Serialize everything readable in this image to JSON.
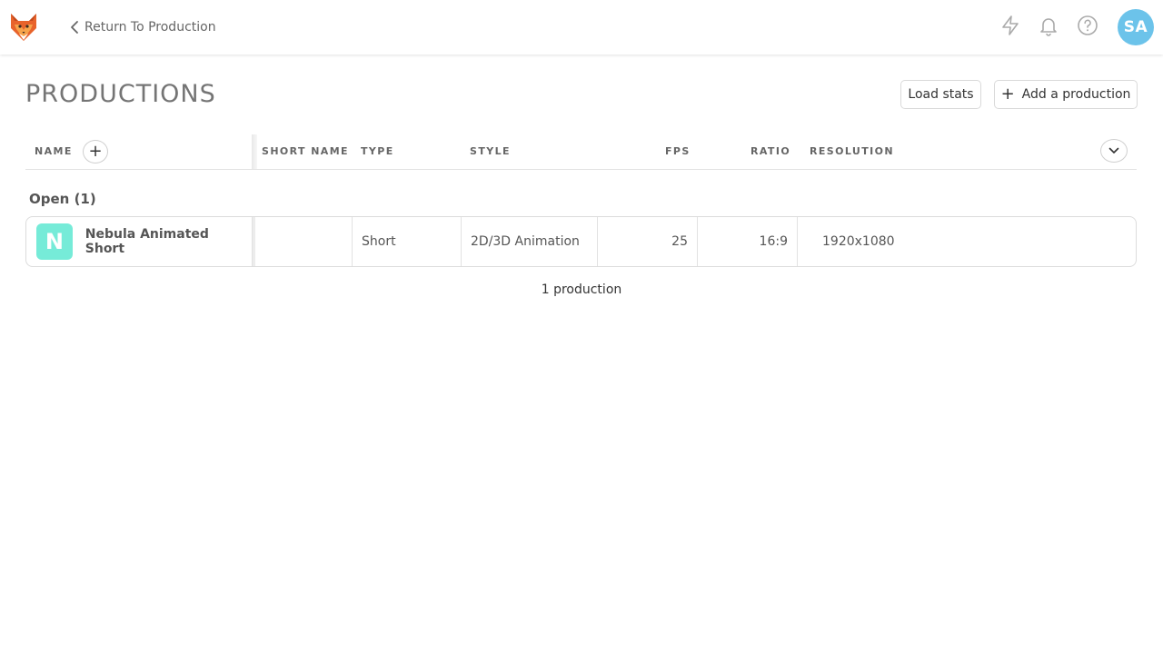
{
  "header": {
    "back_label": "Return To Production",
    "avatar_initials": "SA",
    "avatar_color": "#6cc3ea",
    "icons": [
      "kitsu-fox-logo",
      "lightning-icon",
      "bell-icon",
      "help-icon",
      "chevron-left-icon"
    ]
  },
  "page": {
    "title": "PRODUCTIONS",
    "load_stats_label": "Load stats",
    "add_production_label": "Add a production"
  },
  "table": {
    "columns": {
      "name": "NAME",
      "short_name": "SHORT NAME",
      "type": "TYPE",
      "style": "STYLE",
      "fps": "FPS",
      "ratio": "RATIO",
      "resolution": "RESOLUTION"
    },
    "groups": [
      {
        "title": "Open (1)",
        "rows": [
          {
            "initial": "N",
            "avatar_color": "#76ebd8",
            "name": "Nebula Animated Short",
            "short_name": "",
            "type": "Short",
            "style": "2D/3D Animation",
            "fps": "25",
            "ratio": "16:9",
            "resolution": "1920x1080"
          }
        ]
      }
    ],
    "footer": "1 production"
  }
}
